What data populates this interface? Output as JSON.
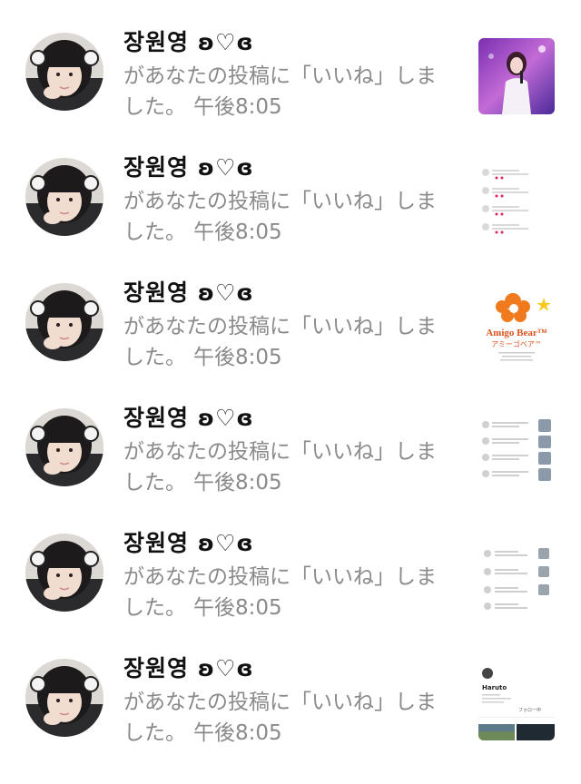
{
  "notifications": [
    {
      "user": "장원영 ʚ♡ɞ",
      "message": "があなたの投稿に「いいね」しました。",
      "time": "午後8:05",
      "thumbnail": "concert-photo"
    },
    {
      "user": "장원영 ʚ♡ɞ",
      "message": "があなたの投稿に「いいね」しました。",
      "time": "午後8:05",
      "thumbnail": "comment-list-screenshot"
    },
    {
      "user": "장원영 ʚ♡ɞ",
      "message": "があなたの投稿に「いいね」しました。",
      "time": "午後8:05",
      "thumbnail": "amigo-bear-logo",
      "thumbnail_text": [
        "Amigo Bear™",
        "アミーゴベア™"
      ]
    },
    {
      "user": "장원영 ʚ♡ɞ",
      "message": "があなたの投稿に「いいね」しました。",
      "time": "午後8:05",
      "thumbnail": "comment-list-with-photos"
    },
    {
      "user": "장원영 ʚ♡ɞ",
      "message": "があなたの投稿に「いいね」しました。",
      "time": "午後8:05",
      "thumbnail": "follower-list-screenshot"
    },
    {
      "user": "장원영 ʚ♡ɞ",
      "message": "があなたの投稿に「いいね」しました。",
      "time": "午後8:05",
      "thumbnail": "profile-screenshot",
      "thumbnail_text": [
        "Haruto",
        "フォロー中"
      ]
    }
  ],
  "colors": {
    "name": "#111111",
    "message": "#8a8a8a",
    "heart": "#e0245e",
    "bear_orange": "#f07a1c"
  }
}
